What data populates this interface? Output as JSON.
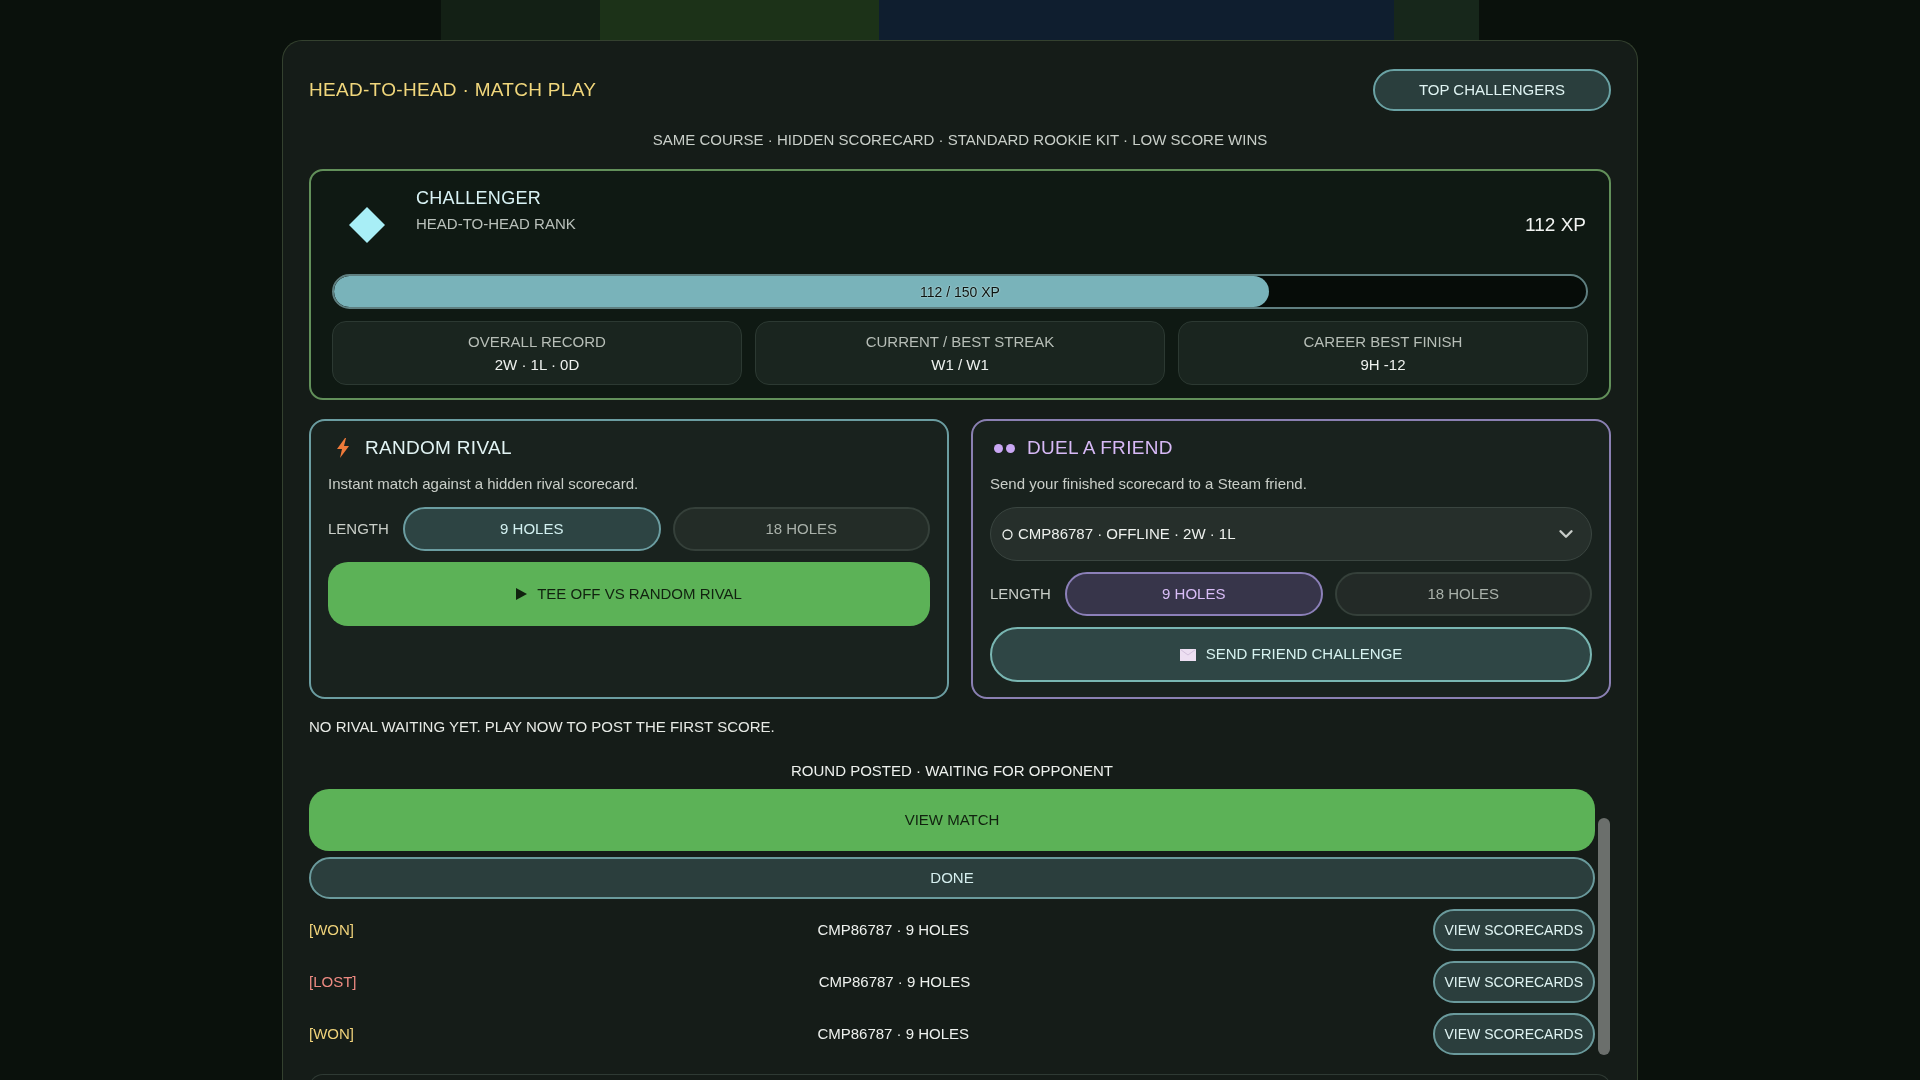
{
  "header": {
    "title": "HEAD-TO-HEAD · MATCH PLAY",
    "button": "TOP CHALLENGERS"
  },
  "subtitle": "SAME COURSE · HIDDEN SCORECARD · STANDARD ROOKIE KIT · LOW SCORE WINS",
  "rank": {
    "name": "CHALLENGER",
    "label": "HEAD-TO-HEAD RANK",
    "xp": "112 XP",
    "progress": {
      "level": 0.7467,
      "reading": "112 / 150 XP"
    },
    "stats": [
      {
        "label": "OVERALL RECORD",
        "value": "2W · 1L · 0D"
      },
      {
        "label": "CURRENT / BEST STREAK",
        "value": "W1 / W1"
      },
      {
        "label": "CAREER BEST FINISH",
        "value": "9H -12"
      }
    ]
  },
  "modes": [
    {
      "kind": "random",
      "title": "RANDOM RIVAL",
      "description": "Instant match against a hidden rival scorecard.",
      "length_label": "LENGTH",
      "lengths": [
        {
          "label": "9 HOLES",
          "selected": true
        },
        {
          "label": "18 HOLES",
          "selected": false
        }
      ],
      "action": "TEE OFF VS RANDOM RIVAL"
    },
    {
      "kind": "friend",
      "title": "DUEL A FRIEND",
      "description": "Send your finished scorecard to a Steam friend.",
      "friend_select": {
        "value": "CMP86787 · OFFLINE · 2W · 1L",
        "online": false
      },
      "length_label": "LENGTH",
      "lengths": [
        {
          "label": "9 HOLES",
          "selected": true
        },
        {
          "label": "18 HOLES",
          "selected": false
        }
      ],
      "action": "SEND FRIEND CHALLENGE"
    }
  ],
  "notice": "NO RIVAL WAITING YET. PLAY NOW TO POST THE FIRST SCORE.",
  "pending": {
    "status": "ROUND POSTED · WAITING FOR OPPONENT",
    "primary": "VIEW MATCH",
    "secondary": "DONE"
  },
  "history": [
    {
      "result": "[WON]",
      "color": "#efd27a",
      "match": "CMP86787 · 9 HOLES",
      "button": "VIEW SCORECARDS"
    },
    {
      "result": "[LOST]",
      "color": "#ee8b82",
      "match": "CMP86787 · 9 HOLES",
      "button": "VIEW SCORECARDS"
    },
    {
      "result": "[WON]",
      "color": "#efd27a",
      "match": "CMP86787 · 9 HOLES",
      "button": "VIEW SCORECARDS"
    }
  ]
}
